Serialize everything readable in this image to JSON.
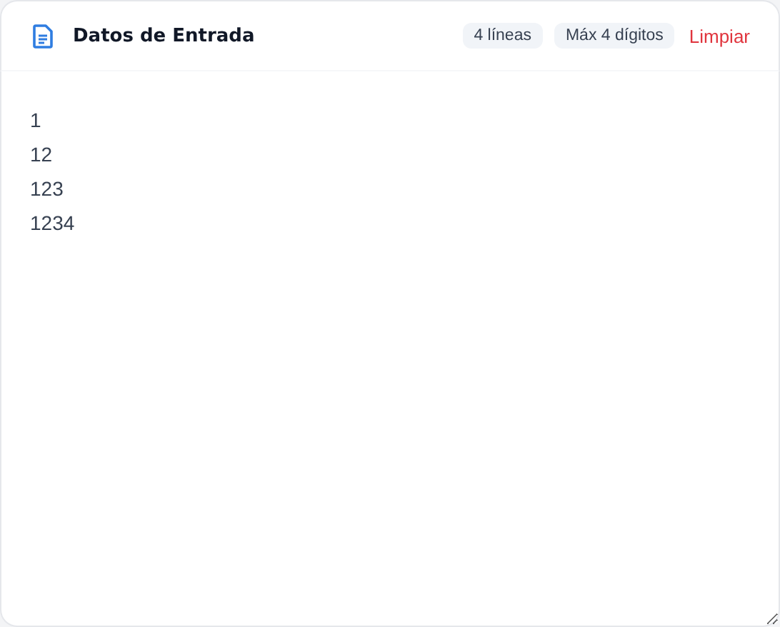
{
  "panel": {
    "title": "Datos de Entrada",
    "badges": [
      "4 líneas",
      "Máx 4 dígitos"
    ],
    "clear_button": "Limpiar"
  },
  "input": {
    "value": "1\n12\n123\n1234"
  }
}
